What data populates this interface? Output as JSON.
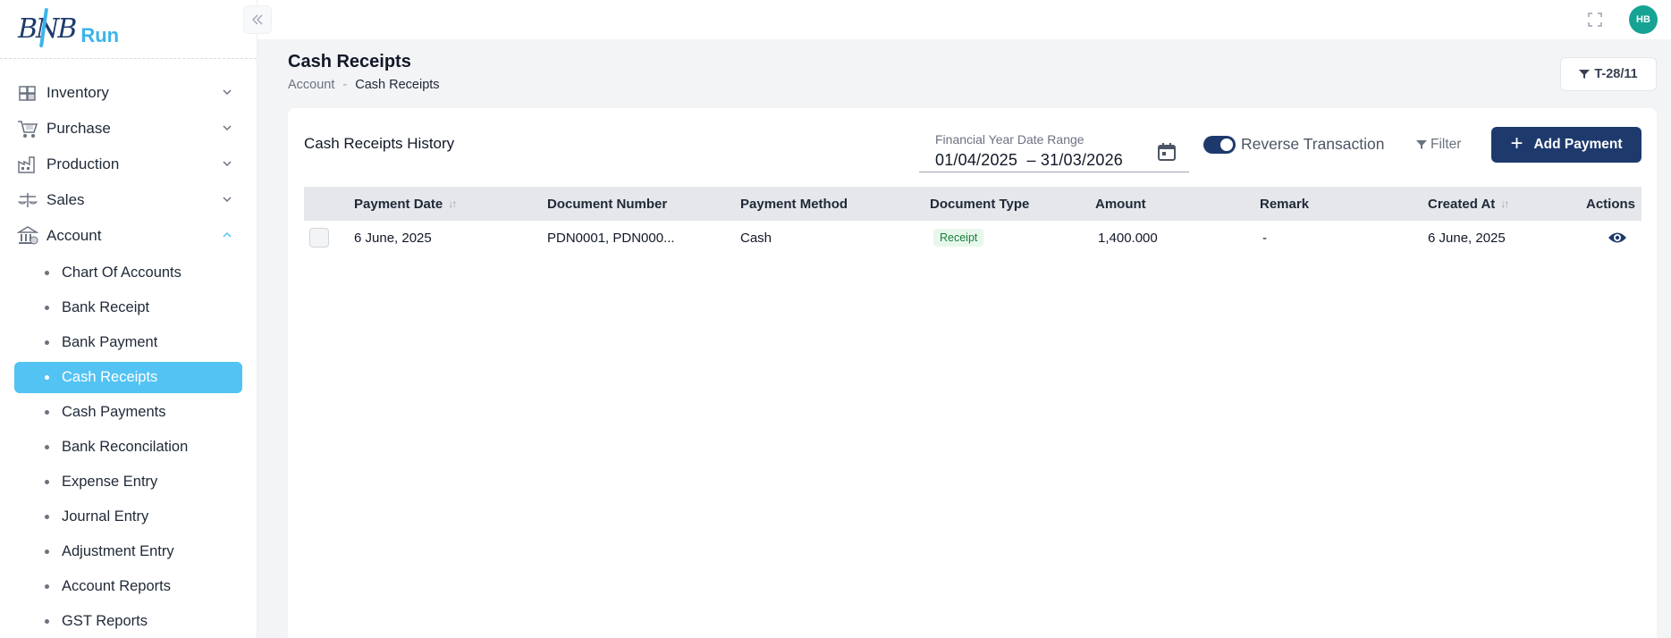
{
  "brand": {
    "logo_text": "BNB",
    "logo_suffix": "Run"
  },
  "topbar": {
    "user_initials": "HB"
  },
  "sidebar": {
    "menu": [
      {
        "label": "Inventory",
        "icon": "boxes-icon",
        "expanded": false
      },
      {
        "label": "Purchase",
        "icon": "cart-icon",
        "expanded": false
      },
      {
        "label": "Production",
        "icon": "factory-icon",
        "expanded": false
      },
      {
        "label": "Sales",
        "icon": "scale-icon",
        "expanded": false
      },
      {
        "label": "Account",
        "icon": "bank-icon",
        "expanded": true
      }
    ],
    "account_submenu": [
      "Chart Of Accounts",
      "Bank Receipt",
      "Bank Payment",
      "Cash Receipts",
      "Cash Payments",
      "Bank Reconcilation",
      "Expense Entry",
      "Journal Entry",
      "Adjustment Entry",
      "Account Reports",
      "GST Reports"
    ],
    "active_item": "Cash Receipts"
  },
  "page": {
    "title": "Cash Receipts",
    "breadcrumb": [
      "Account",
      "Cash Receipts"
    ],
    "tenant_label": "T-28/11"
  },
  "card": {
    "title": "Cash Receipts History",
    "date_range": {
      "label": "Financial Year Date Range",
      "from": "01/04/2025",
      "separator": "–",
      "to": "31/03/2026"
    },
    "reverse_toggle": {
      "label": "Reverse Transaction",
      "on": true
    },
    "filter_label": "Filter",
    "add_button_label": "Add Payment"
  },
  "table": {
    "columns": [
      "Payment Date",
      "Document Number",
      "Payment Method",
      "Document Type",
      "Amount",
      "Remark",
      "Created At",
      "Actions"
    ],
    "rows": [
      {
        "payment_date": "6 June, 2025",
        "document_number": "PDN0001, PDN000...",
        "payment_method": "Cash",
        "document_type": "Receipt",
        "amount": "1,400.000",
        "remark": "-",
        "created_at": "6 June, 2025"
      }
    ]
  },
  "colors": {
    "primary": "#1e3a6d",
    "accent": "#53c3f3",
    "success": "#16803c",
    "avatar": "#16a394"
  }
}
